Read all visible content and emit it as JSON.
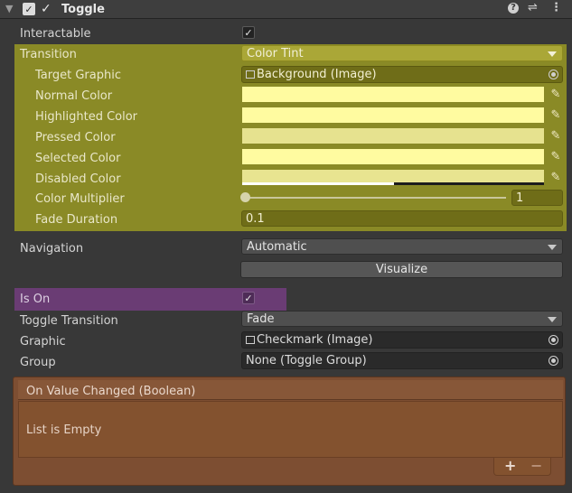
{
  "component": {
    "title": "Toggle",
    "enabled": true
  },
  "fields": {
    "interactable_label": "Interactable",
    "transition_label": "Transition",
    "transition_value": "Color Tint",
    "target_graphic_label": "Target Graphic",
    "target_graphic_value": "Background (Image)",
    "normal_color_label": "Normal Color",
    "highlighted_color_label": "Highlighted Color",
    "pressed_color_label": "Pressed Color",
    "selected_color_label": "Selected Color",
    "disabled_color_label": "Disabled Color",
    "color_multiplier_label": "Color Multiplier",
    "color_multiplier_value": "1",
    "fade_duration_label": "Fade Duration",
    "fade_duration_value": "0.1",
    "navigation_label": "Navigation",
    "navigation_value": "Automatic",
    "visualize_label": "Visualize",
    "is_on_label": "Is On",
    "toggle_transition_label": "Toggle Transition",
    "toggle_transition_value": "Fade",
    "graphic_label": "Graphic",
    "graphic_value": "Checkmark (Image)",
    "group_label": "Group",
    "group_value": "None (Toggle Group)"
  },
  "event": {
    "title": "On Value Changed (Boolean)",
    "empty_text": "List is Empty",
    "add_label": "+",
    "remove_label": "−"
  },
  "colors": {
    "normal": "#fffba0",
    "highlighted": "#fffba0",
    "pressed": "#e6e28f",
    "selected": "#fffba0",
    "disabled": "#e8e490"
  }
}
